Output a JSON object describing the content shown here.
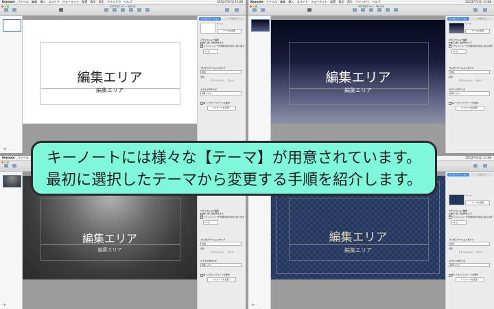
{
  "menubar": {
    "items": [
      "Keynote",
      "ファイル",
      "編集",
      "挿入",
      "スライド",
      "フォーマット",
      "配置",
      "表示",
      "再生",
      "ウインドウ",
      "ヘルプ"
    ],
    "clock": "10月27日(月) 11:08"
  },
  "window": {
    "title": "名称未設定.key — 編集済み"
  },
  "panel": {
    "tabs": [
      "プレゼンテーション",
      "スライド"
    ],
    "theme_name": "テーマ",
    "theme_change_button": "テーマの変更",
    "slideshow_settings": "スライドショー設定",
    "loop_option": "繰り返し自動再生する",
    "idle_option": "スライドショーが待機状態の場合に繰り返す",
    "idle_delay": "15 分",
    "presentation_type": "プレゼンテーションタイプ",
    "type_value": "通常",
    "delay_label": "遅延",
    "transition_label": "トランジション",
    "build_label": "ビルド",
    "slide_size": "スライドのサイズ",
    "size_value": "標準 (4:3)",
    "password_option": "開くときにパスワードを要求",
    "password_button": "パスワードを変更..."
  },
  "slides": [
    {
      "title": "編集エリア",
      "subtitle": "編集エリア"
    },
    {
      "title": "編集エリア",
      "subtitle": "編集エリア"
    },
    {
      "title": "編集エリア",
      "subtitle": "編集エリア"
    },
    {
      "title": "編集エリア",
      "subtitle": "編集エリア"
    }
  ],
  "overlay": {
    "line1": "キーノートには様々な【テーマ】が用意されています。",
    "line2": "最初に選択したテーマから変更する手順を紹介します。"
  },
  "colors": {
    "overlay_bg": "#7ff7da",
    "selection": "#3d7fd6",
    "theme_white_bg": "#ffffff",
    "theme_gradient_dark": "#06081c",
    "theme_gray_dark": "#2e2e2e",
    "theme_navy": "#23365e"
  }
}
